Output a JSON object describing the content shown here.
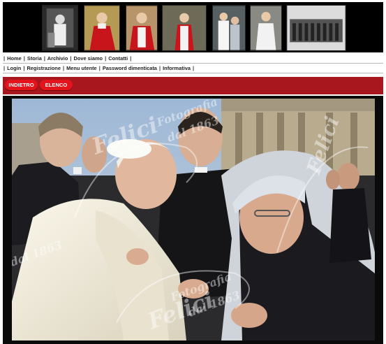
{
  "thumbnails": [
    {
      "icon": "photo-pope-seated-bw"
    },
    {
      "icon": "photo-cardinal-red-portrait"
    },
    {
      "icon": "photo-cardinal-red-blessing"
    },
    {
      "icon": "photo-cardinal-red-standing"
    },
    {
      "icon": "photo-pope-white-with-companion"
    },
    {
      "icon": "photo-pope-white-seated"
    },
    {
      "icon": "photo-guards-group-bw"
    }
  ],
  "nav_primary": [
    "Home",
    "Storia",
    "Archivio",
    "Dove siamo",
    "Contatti"
  ],
  "nav_secondary": [
    "Login",
    "Registrazione",
    "Menu utente",
    "Password dimenticata",
    "Informativa"
  ],
  "buttons": {
    "back": "INDIETRO",
    "list": "ELENCO"
  },
  "watermark": {
    "brand": "Felici",
    "line1": "Fotografia",
    "line2": "dal 1863"
  },
  "colors": {
    "bar": "#a8161e",
    "pill": "#e4141c",
    "strip": "#000000"
  }
}
